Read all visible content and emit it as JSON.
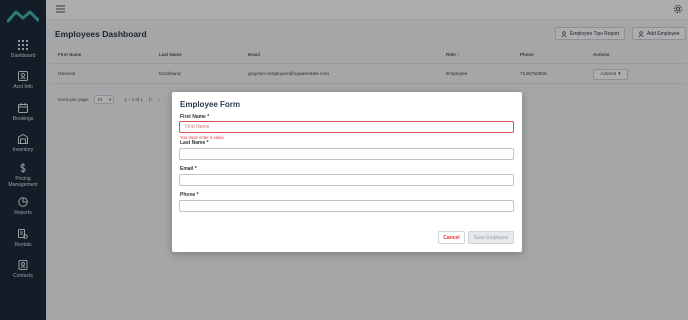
{
  "sidebar": {
    "items": [
      {
        "label": "Dashboard",
        "icon": "grid-icon"
      },
      {
        "label": "Acct Info",
        "icon": "id-card-icon"
      },
      {
        "label": "Bookings",
        "icon": "calendar-icon"
      },
      {
        "label": "Inventory",
        "icon": "inventory-icon"
      },
      {
        "label": "Pricing",
        "label2": "Management",
        "icon": "dollar-icon"
      },
      {
        "label": "Reports",
        "icon": "pie-chart-icon"
      },
      {
        "label": "Rentals",
        "icon": "rentals-icon"
      },
      {
        "label": "Contacts",
        "icon": "contacts-icon"
      }
    ]
  },
  "header": {
    "title": "Employees Dashboard",
    "tips_button": "Employee Tips Report",
    "add_button": "Add Employee"
  },
  "table": {
    "columns": [
      "First Name",
      "Last Name",
      "Email",
      "Role",
      "Phone",
      "Actions"
    ],
    "sort_indicator": "↑",
    "rows": [
      {
        "first": "General",
        "last": "Dockhand",
        "email": "grayson+employee@oquarentals.com",
        "role": "Employee",
        "phone": "7146752806",
        "actions": "Actions"
      }
    ]
  },
  "paginator": {
    "label": "Items per page:",
    "per_page": "10",
    "range": "1 – 1 of 1"
  },
  "modal": {
    "title": "Employee Form",
    "fields": {
      "first_name": {
        "label": "First Name *",
        "placeholder": "First Name",
        "value": "",
        "error": "You must enter a value"
      },
      "last_name": {
        "label": "Last Name *",
        "value": ""
      },
      "email": {
        "label": "Email *",
        "value": ""
      },
      "phone": {
        "label": "Phone *",
        "value": ""
      }
    },
    "cancel": "Cancel",
    "save": "Save Employee"
  },
  "colors": {
    "sidebar_bg": "#1b2b3a",
    "logo": "#3fb8b0",
    "error": "#d33333",
    "title": "#2b3a4a"
  }
}
